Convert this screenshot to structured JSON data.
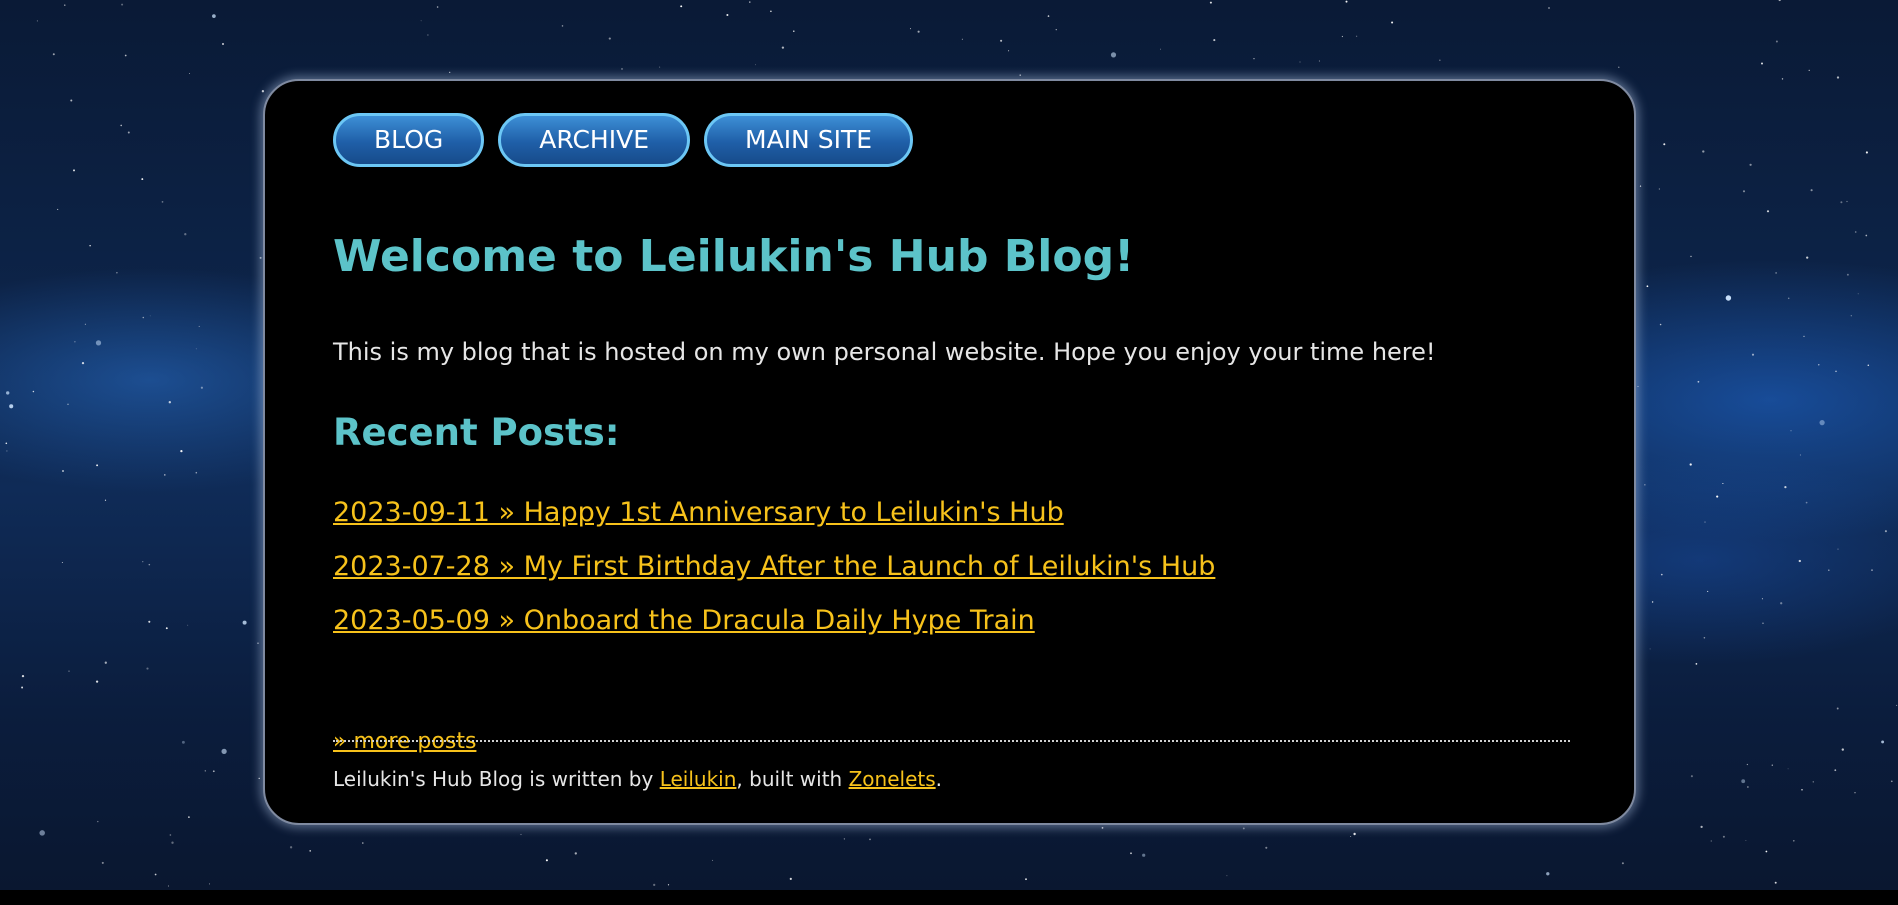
{
  "nav": {
    "items": [
      {
        "label": "BLOG"
      },
      {
        "label": "ARCHIVE"
      },
      {
        "label": "MAIN SITE"
      }
    ]
  },
  "main": {
    "title": "Welcome to Leilukin's Hub Blog!",
    "intro": "This is my blog that is hosted on my own personal website. Hope you enjoy your time here!",
    "recent_heading": "Recent Posts:",
    "posts": [
      {
        "label": "2023-09-11 » Happy 1st Anniversary to Leilukin's Hub"
      },
      {
        "label": "2023-07-28 » My First Birthday After the Launch of Leilukin's Hub"
      },
      {
        "label": "2023-05-09 » Onboard the Dracula Daily Hype Train"
      }
    ],
    "more_posts": "» more posts"
  },
  "footer": {
    "text_before": "Leilukin's Hub Blog is written by ",
    "author_link": "Leilukin",
    "text_middle": ", built with ",
    "builder_link": "Zonelets",
    "text_after": "."
  },
  "colors": {
    "heading": "#5cc3c9",
    "link": "#f7c21b",
    "body_text": "#e6e6e6",
    "nav_button": "#1f5fa8",
    "nav_border": "#6cc7f5",
    "card_background": "#000000"
  },
  "background": {
    "image": "starry-night-sky"
  }
}
